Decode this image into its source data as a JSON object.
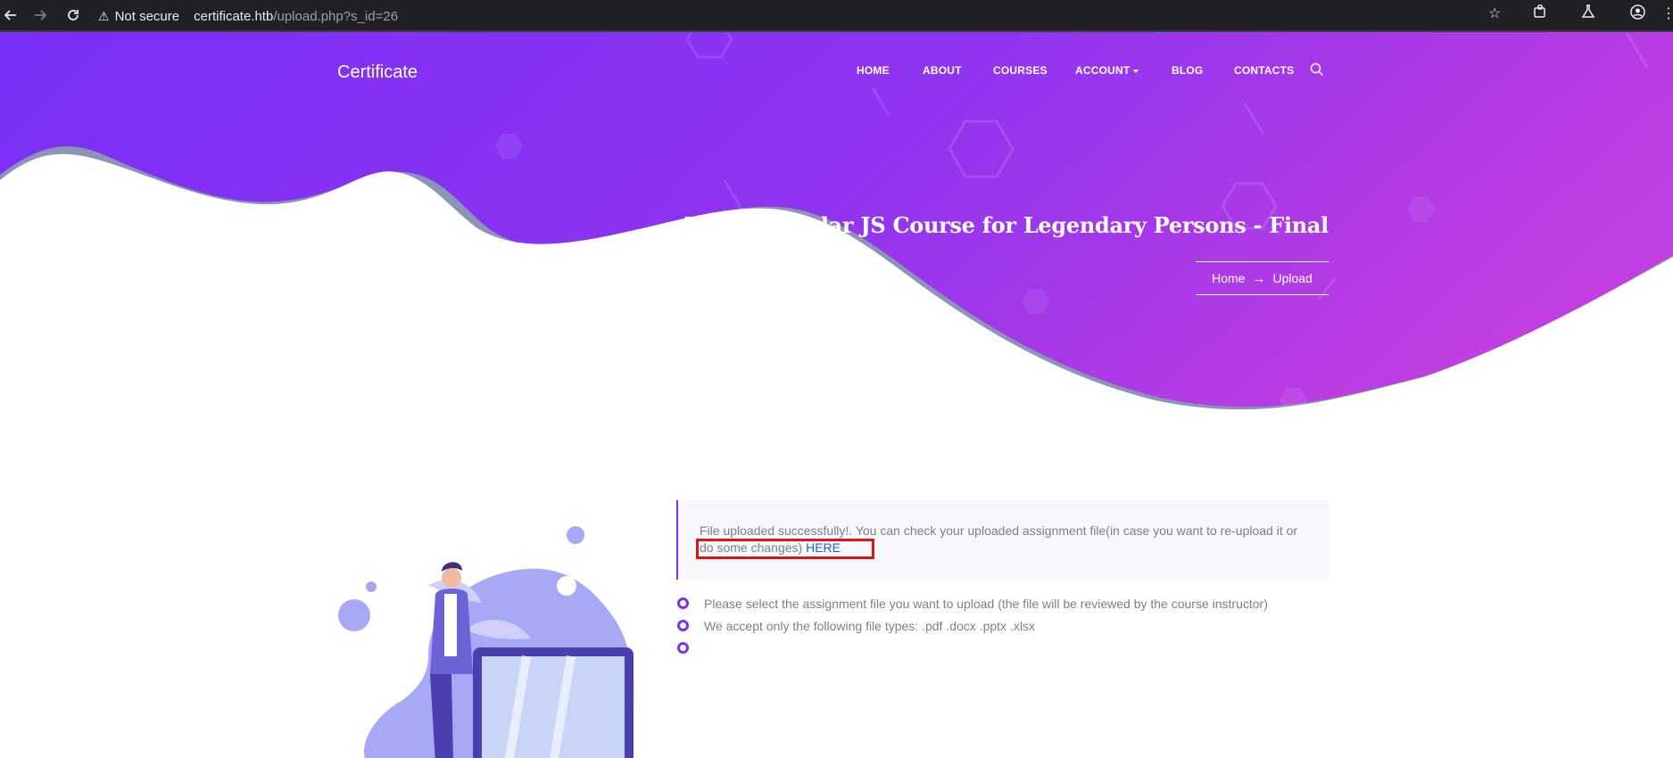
{
  "browser": {
    "security_label": "Not secure",
    "url_host": "certificate.htb",
    "url_path": "/upload.php?s_id=26"
  },
  "site": {
    "brand": "Certificate",
    "nav": {
      "home": "HOME",
      "about": "ABOUT",
      "courses": "COURSES",
      "account": "ACCOUNT",
      "blog": "BLOG",
      "contacts": "CONTACTS"
    }
  },
  "hero": {
    "title": "Learn Angular JS Course for Legendary Persons - Final",
    "breadcrumb": {
      "home": "Home",
      "current": "Upload"
    }
  },
  "upload": {
    "message": "File uploaded successfully!. You can check your uploaded assignment file(in case you want to re-upload it or do some changes)",
    "link_text": "HERE",
    "instructions": [
      "Please select the assignment file you want to upload (the file will be reviewed by the course instructor)",
      "We accept only the following file types: .pdf .docx .pptx .xlsx"
    ]
  },
  "colors": {
    "gradient_start": "#7a2ff7",
    "gradient_end": "#c13ee0",
    "accent": "#7b2ff7",
    "highlight_border": "#e01414",
    "link": "#1565c0"
  },
  "icons": [
    "back-icon",
    "forward-icon",
    "reload-icon",
    "warning-icon",
    "star-icon",
    "extensions-icon",
    "labs-icon",
    "profile-icon",
    "menu-icon",
    "search-icon",
    "arrow-right-icon"
  ]
}
